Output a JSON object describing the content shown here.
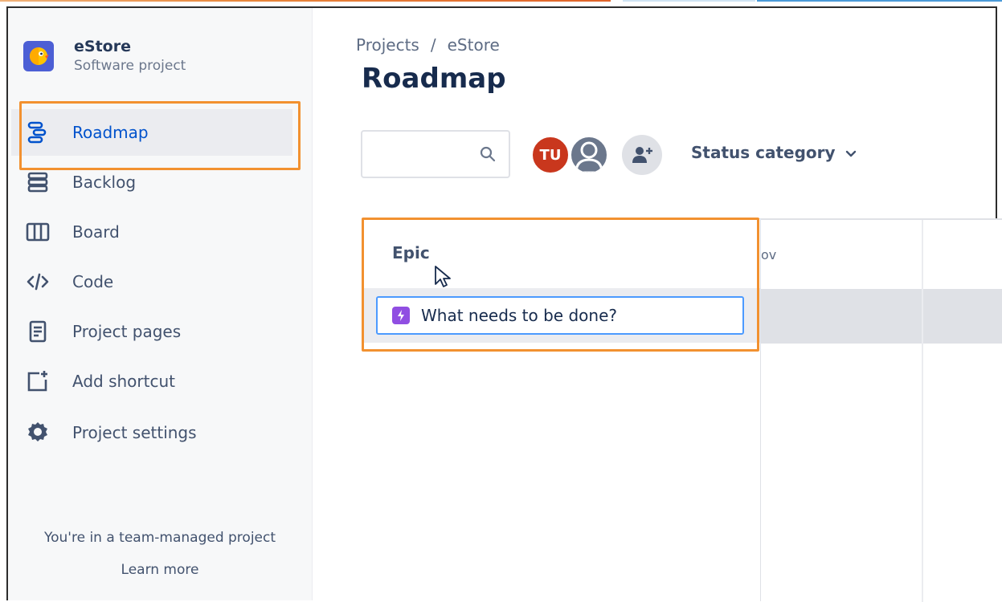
{
  "colors": {
    "accent": "#0052cc",
    "highlight": "#f29130",
    "epic_purple": "#904ee2",
    "avatar_red": "#c9371d"
  },
  "project": {
    "name": "eStore",
    "type": "Software project",
    "icon": "estore-logo-icon"
  },
  "sidebar": {
    "items": [
      {
        "label": "Roadmap",
        "icon": "roadmap-icon",
        "active": true
      },
      {
        "label": "Backlog",
        "icon": "backlog-icon"
      },
      {
        "label": "Board",
        "icon": "board-icon"
      },
      {
        "label": "Code",
        "icon": "code-icon"
      },
      {
        "label": "Project pages",
        "icon": "project-pages-icon"
      },
      {
        "label": "Add shortcut",
        "icon": "add-shortcut-icon"
      },
      {
        "label": "Project settings",
        "icon": "gear-icon"
      }
    ],
    "footer_text": "You're in a team-managed project",
    "learn_more": "Learn more"
  },
  "header": {
    "breadcrumb": [
      "Projects",
      "/",
      "eStore"
    ],
    "title": "Roadmap"
  },
  "toolbar": {
    "search_placeholder": "",
    "search_icon": "search-icon",
    "avatar_initials": "TU",
    "status_filter_label": "Status category",
    "status_filter_icon": "chevron-down-icon"
  },
  "roadmap": {
    "epic_column_header": "Epic",
    "new_epic_placeholder": "What needs to be done?",
    "month_partial": "ov"
  }
}
